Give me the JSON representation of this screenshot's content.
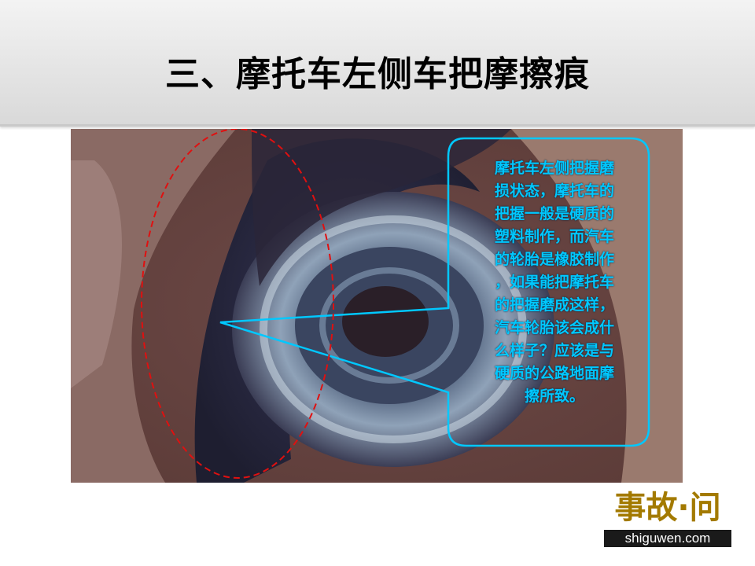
{
  "slide": {
    "title": "三、摩托车左侧车把摩擦痕"
  },
  "photo": {
    "description_icon": "motorcycle-handlebar-grip-photo",
    "highlight_color": "#e01010",
    "callout_color": "#00c8ff",
    "callout_lines": [
      "摩托车左侧把握磨",
      "损状态，摩托车的",
      "把握一般是硬质的",
      "塑料制作，而汽车",
      "的轮胎是橡胶制作",
      "，如果能把摩托车",
      "的把握磨成这样，",
      "汽车轮胎该会成什",
      "么样子？应该是与",
      "硬质的公路地面摩",
      "擦所致。"
    ]
  },
  "logo": {
    "cn": "事故·问",
    "url": "shiguwen.com"
  }
}
